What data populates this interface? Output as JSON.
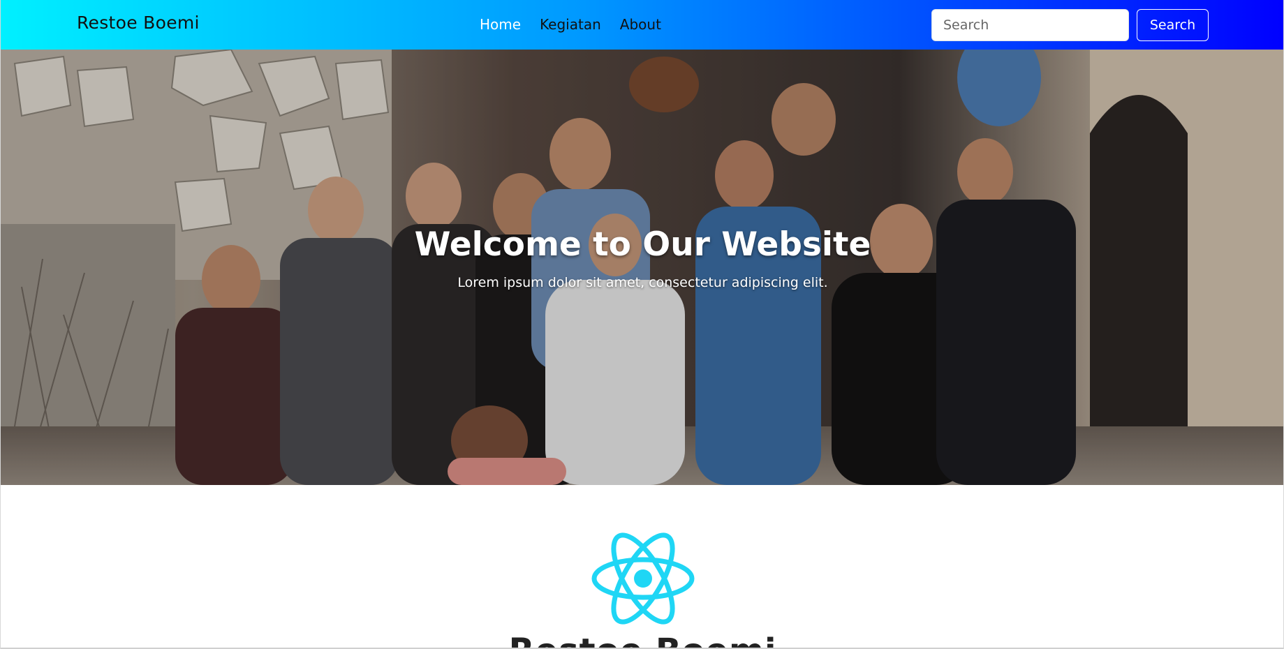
{
  "navbar": {
    "brand": "Restoe Boemi",
    "links": [
      {
        "label": "Home",
        "active": true
      },
      {
        "label": "Kegiatan",
        "active": false
      },
      {
        "label": "About",
        "active": false
      }
    ],
    "search": {
      "placeholder": "Search",
      "value": "",
      "button_label": "Search"
    },
    "gradient_colors": [
      "#00f0ff",
      "#0099ff",
      "#0000ff"
    ]
  },
  "hero": {
    "title": "Welcome to Our Website",
    "subtitle": "Lorem ipsum dolor sit amet, consectetur adipiscing elit."
  },
  "section": {
    "logo_icon": "react-logo-icon",
    "logo_color": "#1fd6f5",
    "title": "Restoe Boemi"
  }
}
